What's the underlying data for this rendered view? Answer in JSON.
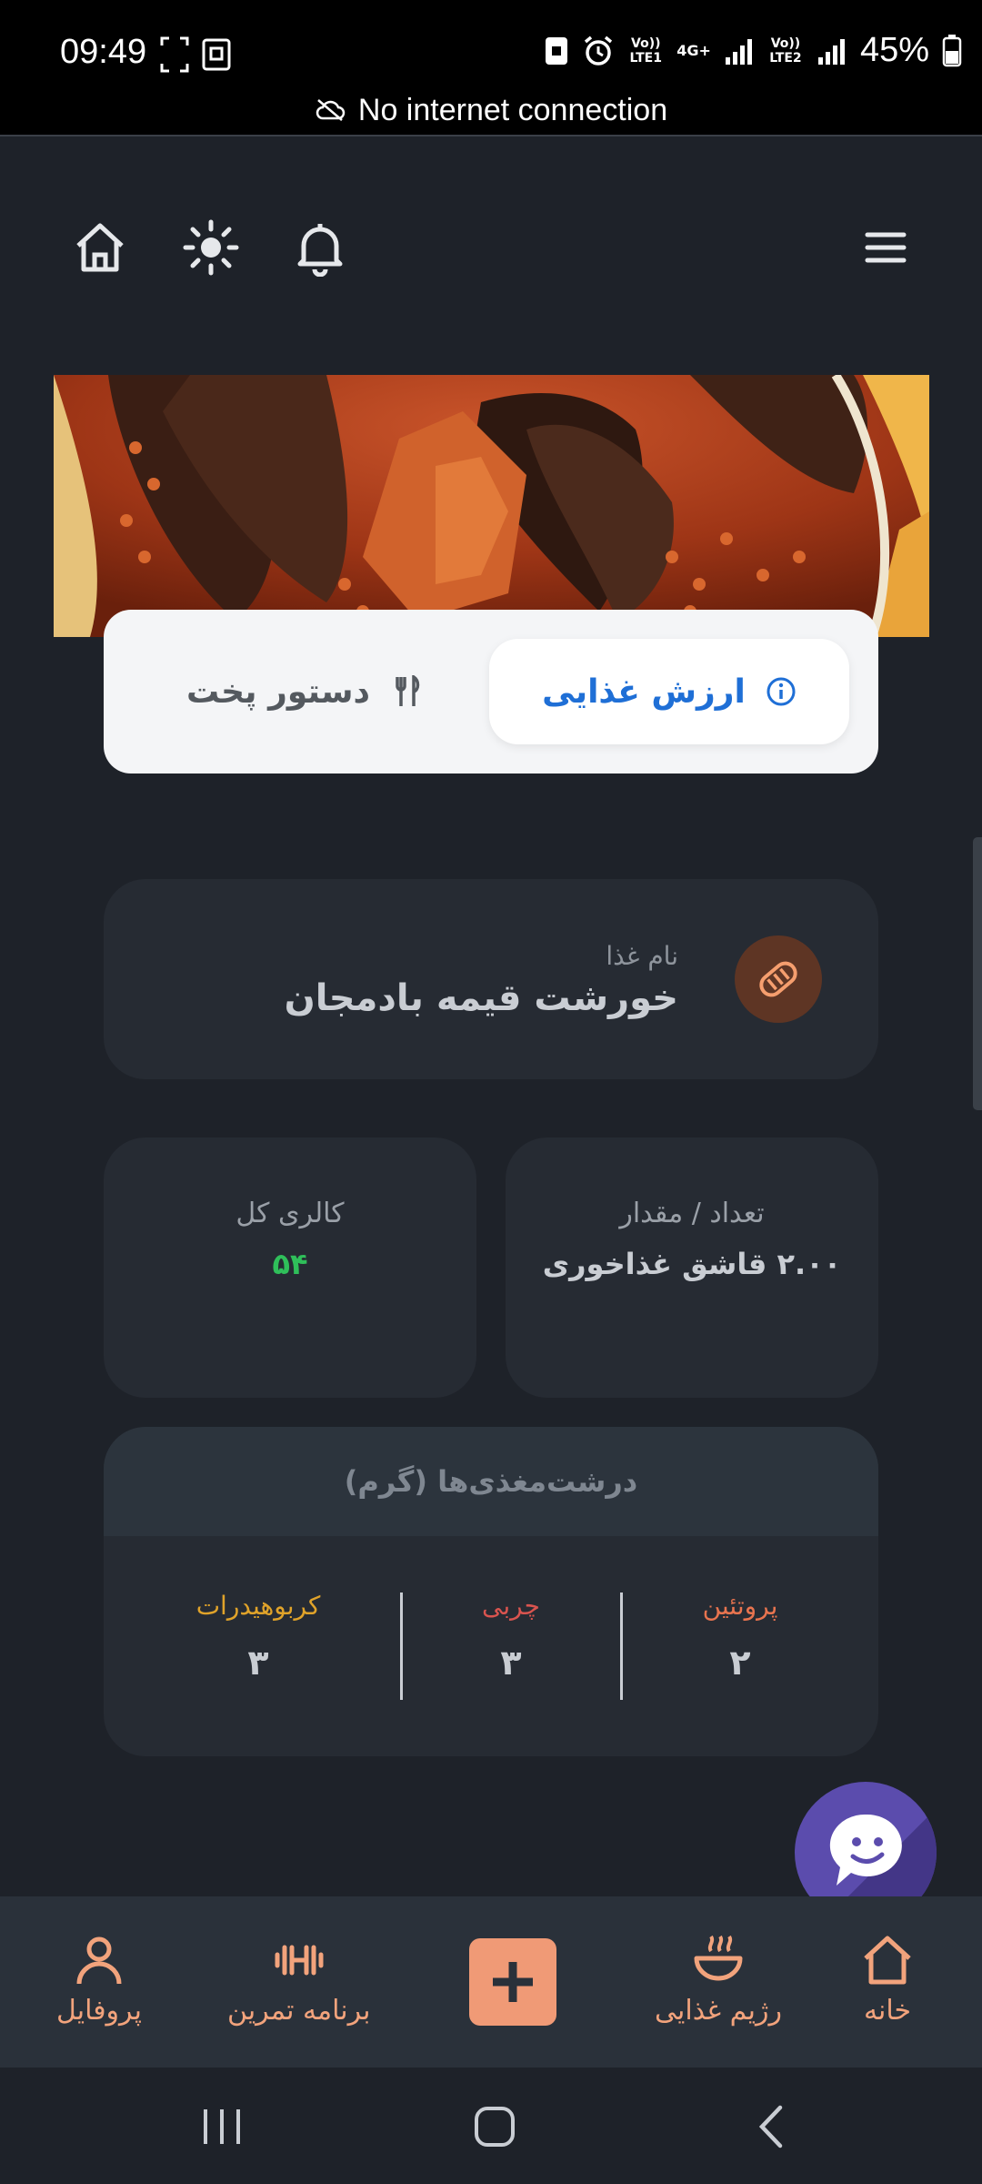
{
  "status_bar": {
    "time": "09:49",
    "battery": "45%",
    "network_labels": [
      "Vo)) LTE1",
      "4G+",
      "Vo)) LTE2"
    ],
    "banner": "No internet connection"
  },
  "top_bar": {
    "icons": [
      "home-icon",
      "brightness-icon",
      "bell-icon",
      "menu-icon"
    ]
  },
  "tabs": {
    "nutrition_label": "ارزش غذایی",
    "recipe_label": "دستور پخت",
    "active": "nutrition"
  },
  "food": {
    "label": "نام غذا",
    "name": "خورشت قیمه بادمجان"
  },
  "quantity": {
    "label": "تعداد / مقدار",
    "value": "۲.۰۰ قاشق غذاخوری"
  },
  "calories": {
    "label": "کالری کل",
    "value": "۵۴"
  },
  "macros": {
    "title": "درشت‌مغذی‌ها (گرم)",
    "protein_label": "پروتئین",
    "protein_value": "۲",
    "fat_label": "چربی",
    "fat_value": "۳",
    "carbs_label": "کربوهیدرات",
    "carbs_value": "۳"
  },
  "bottom_nav": {
    "home": "خانه",
    "diet": "رژیم غذایی",
    "workout": "برنامه تمرین",
    "profile": "پروفایل"
  },
  "colors": {
    "background": "#1e2229",
    "card": "#262b33",
    "accent_blue": "#1f6fd6",
    "nav_accent": "#f2a37c",
    "calorie_green": "#2fbf5a",
    "protein": "#e8744f",
    "fat": "#d9544f",
    "carbs": "#e0a32a",
    "chat_purple": "#5b4cad"
  }
}
